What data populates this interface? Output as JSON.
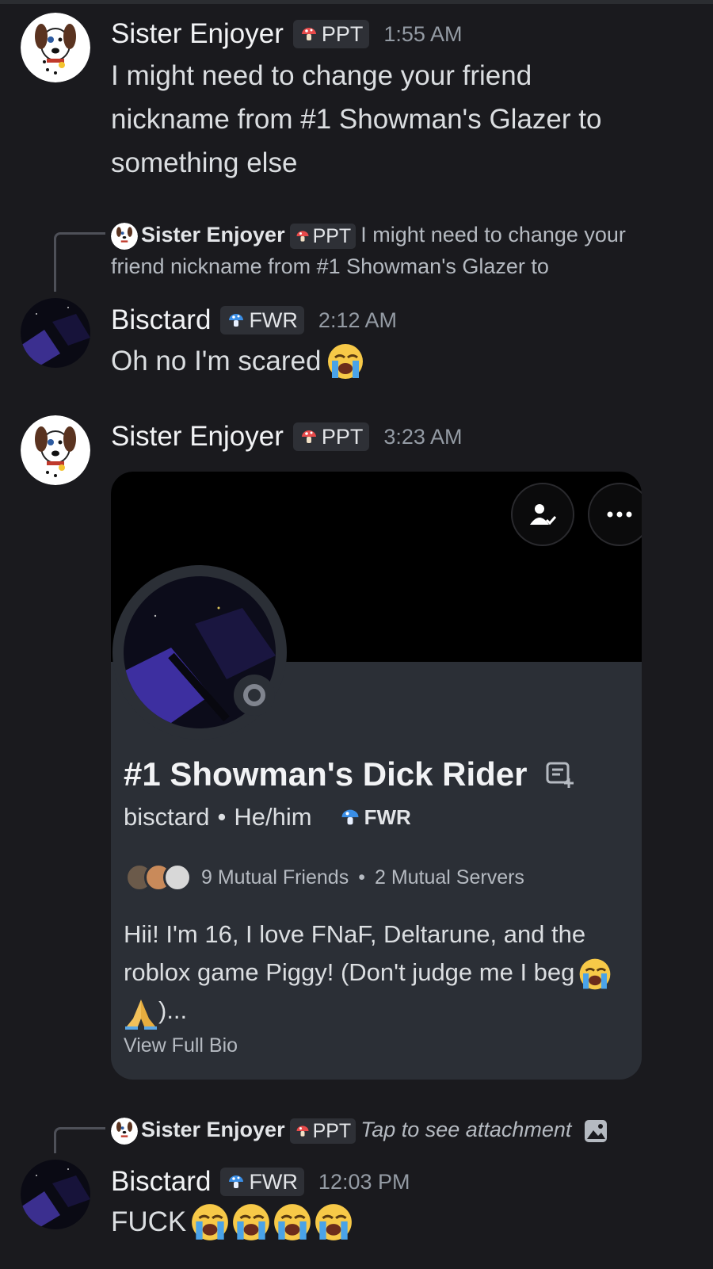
{
  "messages": [
    {
      "author": "Sister Enjoyer",
      "tag": "PPT",
      "time": "1:55 AM",
      "lines": [
        "I might need to change your friend",
        "nickname from #1 Showman's Glazer to",
        "something else"
      ]
    },
    {
      "reply": {
        "author": "Sister Enjoyer",
        "tag": "PPT",
        "text": "I might need to change your friend nickname from #1 Showman's Glazer to"
      },
      "author": "Bisctard",
      "tag": "FWR",
      "time": "2:12 AM",
      "text": "Oh no I'm scared"
    },
    {
      "author": "Sister Enjoyer",
      "tag": "PPT",
      "time": "3:23 AM",
      "profile_card": {
        "display_name": "#1 Showman's Dick Rider",
        "username": "bisctard",
        "separator": "•",
        "pronouns": "He/him",
        "tag": "FWR",
        "mutual_friends": "9 Mutual Friends",
        "mutual_servers": "2 Mutual Servers",
        "bio": "Hii! I'm 16, I love FNaF, Deltarune, and the roblox game Piggy! (Don't judge me I beg",
        "bio_tail": ")...",
        "view_bio": "View Full Bio"
      }
    },
    {
      "reply": {
        "author": "Sister Enjoyer",
        "tag": "PPT",
        "text": "Tap to see attachment"
      },
      "author": "Bisctard",
      "tag": "FWR",
      "time": "12:03 PM",
      "text": "FUCK"
    }
  ],
  "icons": [
    "loudly-crying-emoji",
    "folded-hands-emoji",
    "mushroom-icon",
    "add-friend-icon",
    "more-options-icon",
    "add-note-icon",
    "image-icon"
  ],
  "colors": {
    "background": "#1a1a1e",
    "card": "#2b2f36",
    "banner": "#000000",
    "ppt_mushroom": "#e84a4a",
    "fwr_mushroom": "#3a8ee6"
  }
}
